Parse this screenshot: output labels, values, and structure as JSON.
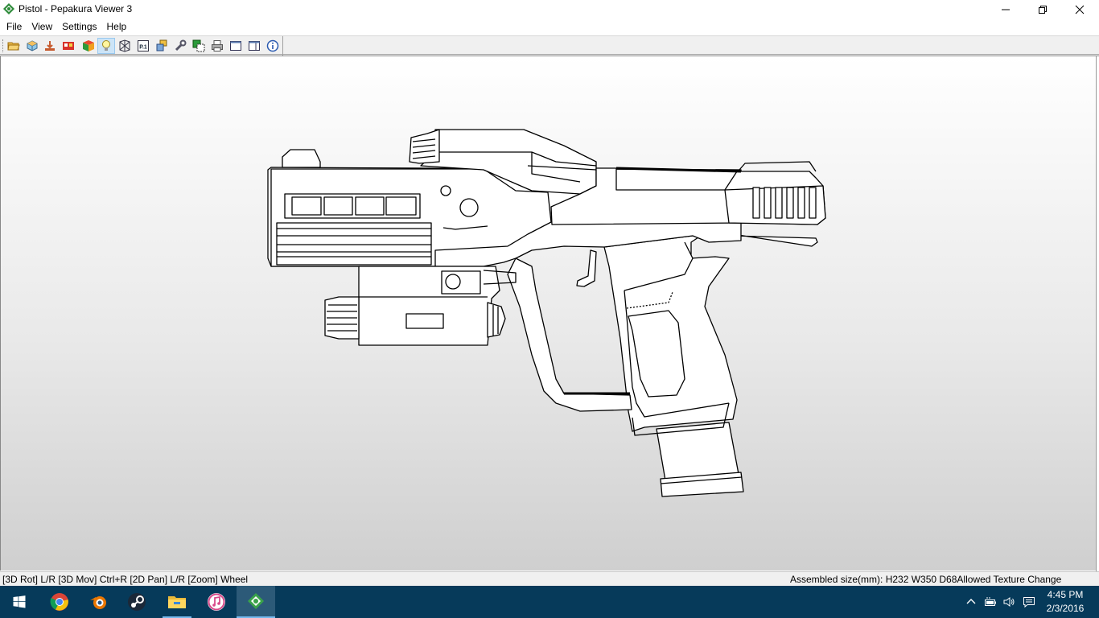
{
  "window": {
    "title": "Pistol - Pepakura Viewer 3",
    "icon": "pepakura-icon",
    "controls": [
      "minimize-icon",
      "restore-icon",
      "close-icon"
    ]
  },
  "menubar": {
    "items": [
      "File",
      "View",
      "Settings",
      "Help"
    ]
  },
  "toolbar": {
    "buttons": [
      {
        "icon": "open-folder-icon"
      },
      {
        "icon": "3d-model-icon"
      },
      {
        "icon": "unfold-icon"
      },
      {
        "icon": "texture-icon"
      },
      {
        "icon": "color-cube-icon"
      },
      {
        "icon": "light-bulb-icon",
        "active": true
      },
      {
        "icon": "wireframe-icon"
      },
      {
        "icon": "page-number-icon",
        "label": "P.1"
      },
      {
        "icon": "parts-icon"
      },
      {
        "icon": "wrench-icon"
      },
      {
        "icon": "layers-icon"
      },
      {
        "icon": "printer-icon"
      },
      {
        "icon": "single-pane-icon"
      },
      {
        "icon": "split-pane-icon"
      },
      {
        "icon": "info-icon"
      }
    ]
  },
  "statusbar": {
    "hint": "[3D Rot] L/R [3D Mov] Ctrl+R [2D Pan] L/R [Zoom] Wheel",
    "info": "Assembled size(mm): H232 W350 D68Allowed Texture Change"
  },
  "taskbar": {
    "apps": [
      {
        "icon": "windows-start-icon"
      },
      {
        "icon": "chrome-icon"
      },
      {
        "icon": "blender-icon"
      },
      {
        "icon": "steam-icon"
      },
      {
        "icon": "file-explorer-icon"
      },
      {
        "icon": "itunes-icon"
      },
      {
        "icon": "pepakura-icon",
        "active": true
      }
    ],
    "tray_icons": [
      "chevron-up-icon",
      "battery-icon",
      "volume-icon",
      "notification-icon"
    ],
    "time": "4:45 PM",
    "date": "2/3/2016"
  },
  "colors": {
    "taskbar": "#063a5a",
    "active_task": "#2c5a78",
    "toolbar": "#f0f0f0"
  }
}
